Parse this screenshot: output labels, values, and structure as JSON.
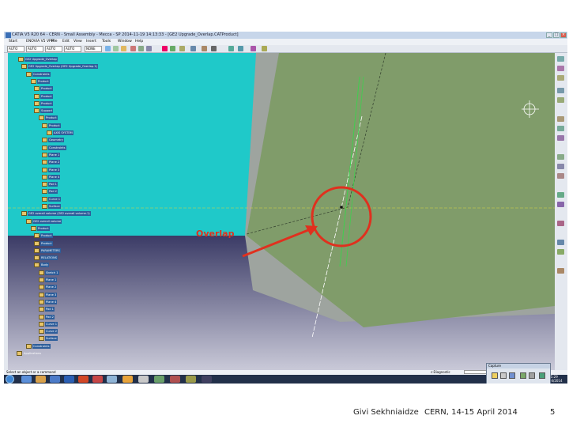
{
  "window": {
    "title": "CATIA V5 R20 64 - CERN - Small Assembly - Mecca - SP 2014-11-19 14:13:33 - [GE2 Upgrade_Overlap.CATProduct]",
    "minimize": "_",
    "maximize": "□",
    "close": "×"
  },
  "menu": [
    "Start",
    "ENOVIA V5 VPM",
    "File",
    "Edit",
    "View",
    "Insert",
    "Tools",
    "Window",
    "Help"
  ],
  "toolbar": {
    "select1": "AUTO",
    "select2": "AUTO",
    "select3": "AUTO",
    "select4": "AUTO",
    "select5": "NONE"
  },
  "tree": [
    {
      "label": "GE2 Upgrade_Overlap",
      "selected": true
    },
    {
      "label": "GE2 Upgrade_Overlap (GE2 Upgrade_Overlap.1)",
      "selected": true
    },
    {
      "label": "Constraints",
      "selected": true
    },
    {
      "label": "Product",
      "selected": true
    },
    {
      "label": "Product",
      "selected": true
    },
    {
      "label": "Product",
      "selected": true
    },
    {
      "label": "Product",
      "selected": true
    },
    {
      "label": "Support",
      "selected": true
    },
    {
      "label": "Product",
      "selected": true
    },
    {
      "label": "Product",
      "selected": true
    },
    {
      "label": "AXIS SYSTEM",
      "selected": true
    },
    {
      "label": "Geometry",
      "selected": true
    },
    {
      "label": "Constraints",
      "selected": true
    },
    {
      "label": "Plane 1",
      "selected": true
    },
    {
      "label": "Plane 2",
      "selected": true
    },
    {
      "label": "Plane 3",
      "selected": true
    },
    {
      "label": "Plane 4",
      "selected": true
    },
    {
      "label": "Pad 1",
      "selected": true
    },
    {
      "label": "Pad 2",
      "selected": true
    },
    {
      "label": "Curve 1",
      "selected": true
    },
    {
      "label": "Surface",
      "selected": true
    },
    {
      "label": "GE2 overall volume (GE2 overall volume.1)",
      "selected": true
    },
    {
      "label": "GE2 overall volume",
      "selected": true
    },
    {
      "label": "Product",
      "selected": true
    },
    {
      "label": "Product",
      "selected": true
    },
    {
      "label": "Product",
      "selected": true
    },
    {
      "label": "PARAMETERS",
      "selected": true
    },
    {
      "label": "RELATIONS",
      "selected": true
    },
    {
      "label": "Body",
      "selected": true
    },
    {
      "label": "Sketch 1",
      "selected": true
    },
    {
      "label": "Plane 1",
      "selected": true
    },
    {
      "label": "Plane 2",
      "selected": true
    },
    {
      "label": "Plane 3",
      "selected": true
    },
    {
      "label": "Plane 4",
      "selected": true
    },
    {
      "label": "Pad 1",
      "selected": true
    },
    {
      "label": "Pad 2",
      "selected": true
    },
    {
      "label": "Curve 1",
      "selected": true
    },
    {
      "label": "Curve 2",
      "selected": true
    },
    {
      "label": "Surface",
      "selected": true
    },
    {
      "label": "Constraints",
      "selected": true
    },
    {
      "label": "Applications",
      "selected": false
    }
  ],
  "annotation": {
    "overlap_label": "Overlap"
  },
  "statusbar": {
    "message": "Select an object or a command",
    "command_label": "c:Diagnostic"
  },
  "palette": {
    "title": "Capture"
  },
  "taskbar": {
    "time": "15:29",
    "date": "10/04/2014"
  },
  "footer": {
    "author": "Givi Sekhniaidze",
    "event": "CERN, 14-15 April 2014",
    "page": "5"
  },
  "colors": {
    "background_cyan": "#1fc9c9",
    "background_navy": "#3b3b66",
    "gray_surface": "#a9b0ac",
    "green_surface": "#809c6a",
    "annotation_red": "#e0301e",
    "highlight_green": "#3fcf4f"
  }
}
